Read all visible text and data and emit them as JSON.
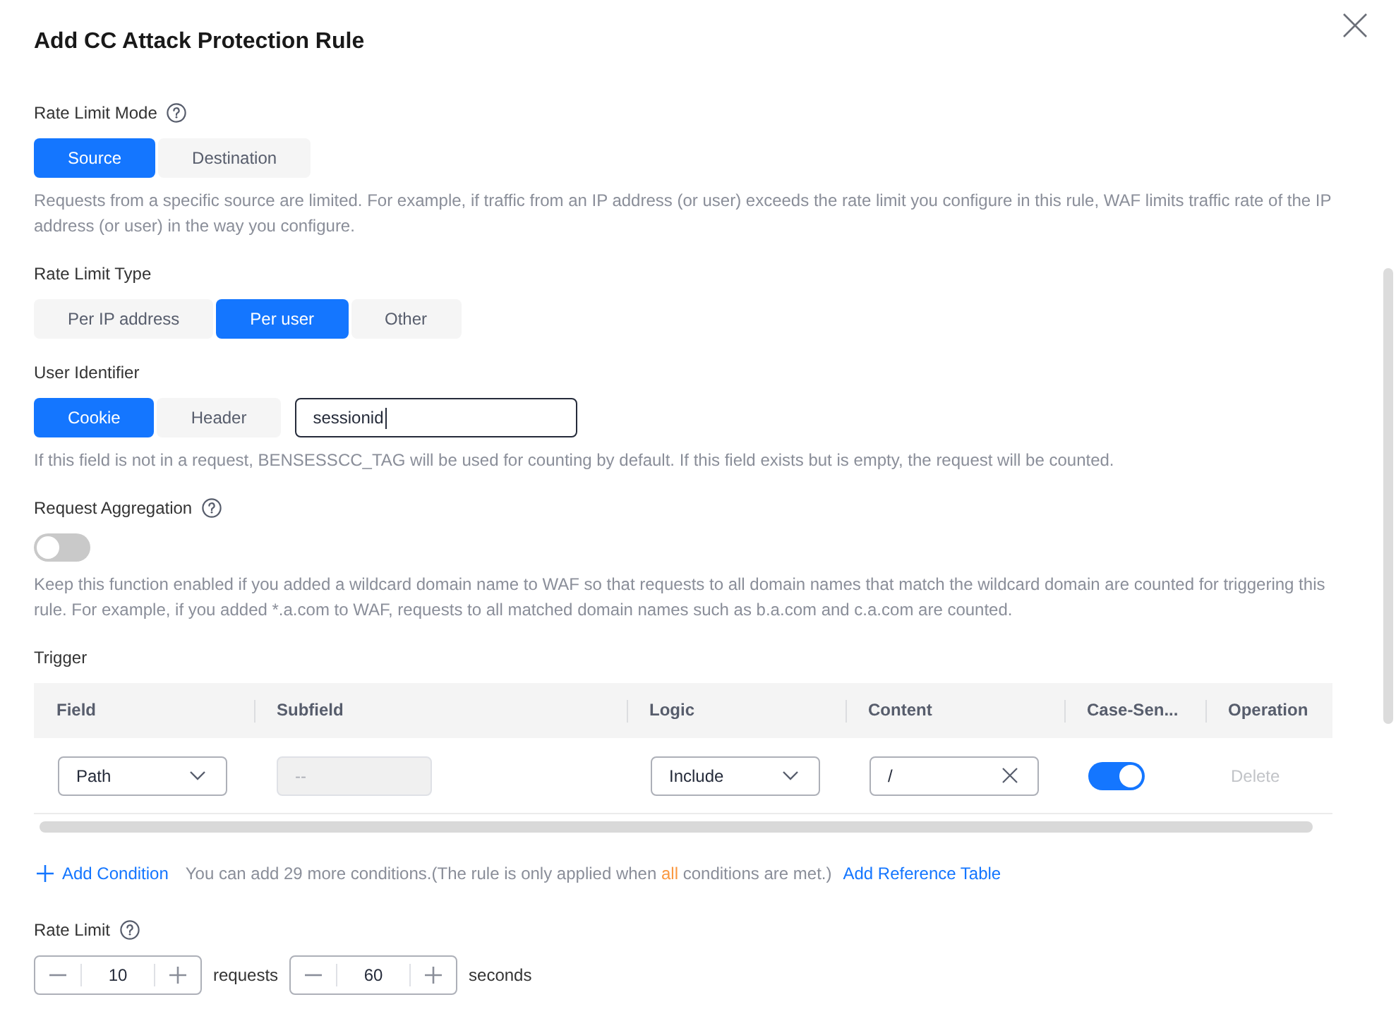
{
  "dialog": {
    "title": "Add CC Attack Protection Rule"
  },
  "rate_limit_mode": {
    "label": "Rate Limit Mode",
    "help": true,
    "options": [
      {
        "label": "Source",
        "selected": true
      },
      {
        "label": "Destination",
        "selected": false
      }
    ],
    "description": "Requests from a specific source are limited. For example, if traffic from an IP address (or user) exceeds the rate limit you configure in this rule, WAF limits traffic rate of the IP address (or user) in the way you configure."
  },
  "rate_limit_type": {
    "label": "Rate Limit Type",
    "help": false,
    "options": [
      {
        "label": "Per IP address",
        "selected": false
      },
      {
        "label": "Per user",
        "selected": true
      },
      {
        "label": "Other",
        "selected": false
      }
    ]
  },
  "user_identifier": {
    "label": "User Identifier",
    "help": false,
    "options": [
      {
        "label": "Cookie",
        "selected": true
      },
      {
        "label": "Header",
        "selected": false
      }
    ],
    "value": "sessionid",
    "focused": true,
    "description": "If this field is not in a request, BENSESSCC_TAG will be used for counting by default. If this field exists but is empty, the request will be counted."
  },
  "request_aggregation": {
    "label": "Request Aggregation",
    "help": true,
    "on": false,
    "description": "Keep this function enabled if you added a wildcard domain name to WAF so that requests to all domain names that match the wildcard domain are counted for triggering this rule. For example, if you added *.a.com to WAF, requests to all matched domain names such as b.a.com and c.a.com are counted."
  },
  "trigger": {
    "label": "Trigger",
    "help": false,
    "table": {
      "columns": [
        "Field",
        "Subfield",
        "Logic",
        "Content",
        "Case-Sen...",
        "Operation"
      ],
      "rows": [
        {
          "cells": [
            {
              "kind": "select",
              "value": "Path"
            },
            {
              "kind": "input",
              "placeholder": "--",
              "disabled": true
            },
            {
              "kind": "select",
              "value": "Include"
            },
            {
              "kind": "clearable",
              "value": "/"
            },
            {
              "kind": "toggle",
              "on": true
            },
            {
              "kind": "action",
              "label": "Delete",
              "disabled": true
            }
          ]
        }
      ]
    }
  },
  "add_condition": {
    "link": "Add Condition",
    "note": [
      {
        "text": "You can add 29 more conditions.(The rule is only applied when ",
        "highlight": false
      },
      {
        "text": "all",
        "highlight": true
      },
      {
        "text": " conditions are met.)",
        "highlight": false
      }
    ],
    "reference_link": "Add Reference Table"
  },
  "rate_limit": {
    "label": "Rate Limit",
    "help": true,
    "requests": {
      "value": "10",
      "unit": "requests"
    },
    "period": {
      "value": "60",
      "unit": "seconds"
    }
  }
}
